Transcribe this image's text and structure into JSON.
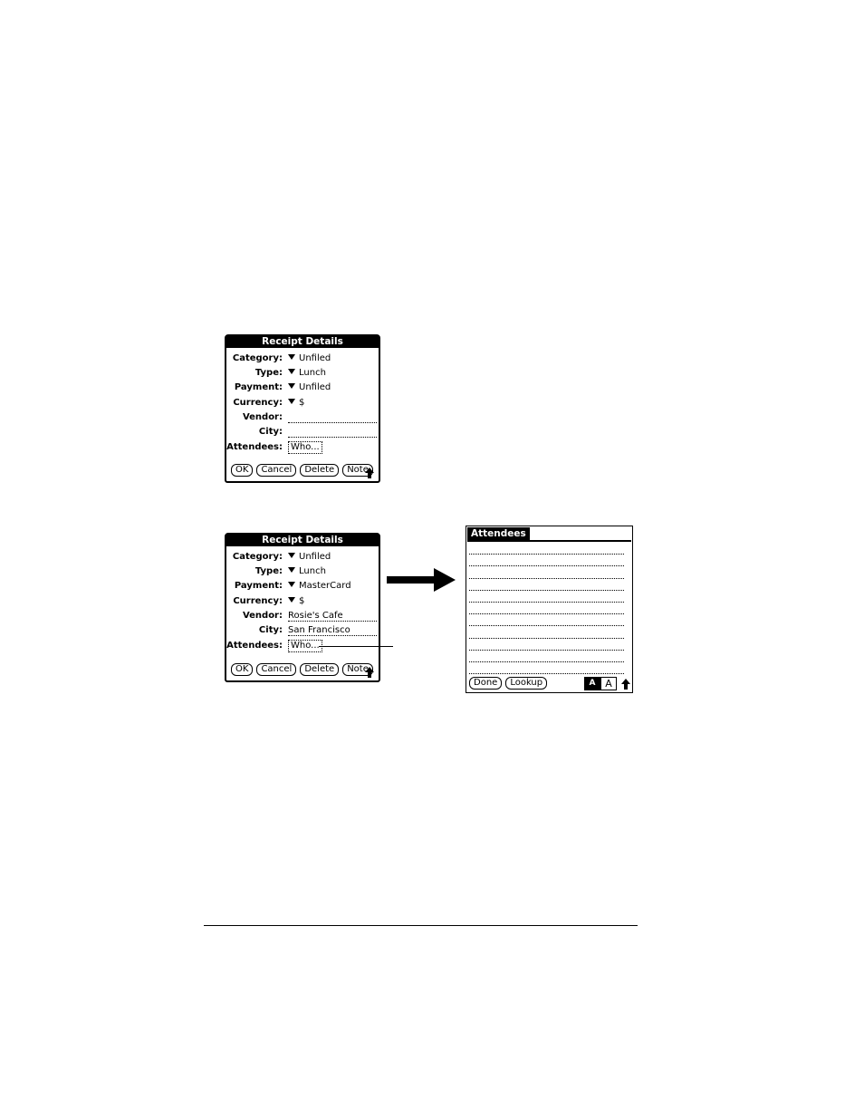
{
  "dialog_top": {
    "title": "Receipt Details",
    "fields": {
      "category": {
        "label": "Category:",
        "value": "Unfiled"
      },
      "type": {
        "label": "Type:",
        "value": "Lunch"
      },
      "payment": {
        "label": "Payment:",
        "value": "Unfiled"
      },
      "currency": {
        "label": "Currency:",
        "value": "$"
      },
      "vendor": {
        "label": "Vendor:",
        "value": ""
      },
      "city": {
        "label": "City:",
        "value": ""
      },
      "attendees": {
        "label": "Attendees:",
        "value": "Who..."
      }
    },
    "buttons": {
      "ok": "OK",
      "cancel": "Cancel",
      "delete": "Delete",
      "note": "Note"
    }
  },
  "dialog_bottom": {
    "title": "Receipt Details",
    "fields": {
      "category": {
        "label": "Category:",
        "value": "Unfiled"
      },
      "type": {
        "label": "Type:",
        "value": "Lunch"
      },
      "payment": {
        "label": "Payment:",
        "value": "MasterCard"
      },
      "currency": {
        "label": "Currency:",
        "value": "$"
      },
      "vendor": {
        "label": "Vendor:",
        "value": "Rosie's Cafe"
      },
      "city": {
        "label": "City:",
        "value": "San Francisco"
      },
      "attendees": {
        "label": "Attendees:",
        "value": "Who..."
      }
    },
    "buttons": {
      "ok": "OK",
      "cancel": "Cancel",
      "delete": "Delete",
      "note": "Note"
    }
  },
  "attendees_screen": {
    "title": "Attendees",
    "buttons": {
      "done": "Done",
      "lookup": "Lookup"
    },
    "shift_indicator": {
      "caps": "A",
      "normal": "A"
    }
  },
  "icons": {
    "dropdown": "triangle-down-icon",
    "shift": "up-arrow-icon",
    "flow": "right-arrow-icon"
  }
}
